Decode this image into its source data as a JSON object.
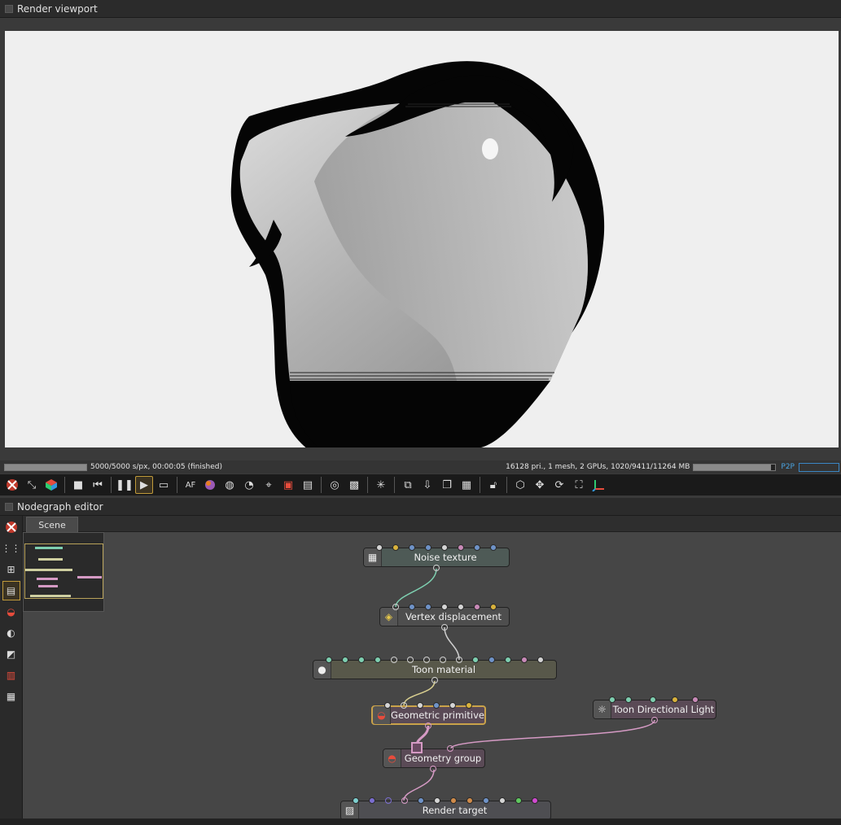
{
  "render_viewport": {
    "title": "Render viewport",
    "status_left": "5000/5000 s/px, 00:00:05 (finished)",
    "status_right": "16128 pri., 1 mesh, 2 GPUs, 1020/9411/11264 MB",
    "p2p_label": "P2P",
    "render_progress": 1.0,
    "memory_progress": 0.95
  },
  "toolbar": {
    "icons": [
      "octane-logo-icon",
      "fit-icon",
      "cube-color-icon",
      "stop-icon",
      "rewind-icon",
      "pause-icon",
      "play-icon",
      "monitor-icon",
      "af-icon",
      "color-icon",
      "material-picker-icon",
      "focus-picker-icon",
      "white-balance-icon",
      "render-region-icon",
      "film-region-icon",
      "zoom-icon",
      "background-icon",
      "viewport-lock-icon",
      "clay-icon",
      "stack-icon",
      "copy-icon",
      "checker-icon",
      "unlock-icon",
      "camera-cube-icon",
      "move-icon",
      "rotate-icon",
      "fullscreen-icon",
      "gizmo-axes-icon"
    ],
    "af_label": "AF"
  },
  "nodegraph": {
    "title": "Nodegraph editor",
    "tab": "Scene",
    "nodes": {
      "noise_texture": "Noise texture",
      "vertex_displacement": "Vertex displacement",
      "toon_material": "Toon material",
      "geometric_primitive": "Geometric primitive",
      "toon_directional_light": "Toon Directional Light",
      "geometry_group": "Geometry group",
      "render_target": "Render target"
    }
  },
  "colors": {
    "selection": "#c9a24a",
    "pin_teal": "#7ecfb0",
    "pin_yellow": "#d9b23c",
    "pin_blue": "#6f93c8",
    "pin_pink": "#c98ab8",
    "pin_white": "#d5d5d5",
    "link_pink": "#d59ac4"
  }
}
